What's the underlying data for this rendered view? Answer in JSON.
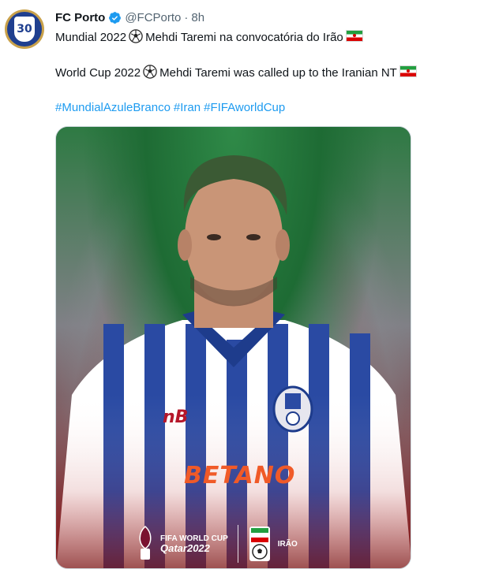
{
  "tweet": {
    "author_name": "FC Porto",
    "handle": "@FCPorto",
    "separator": "·",
    "time": "8h",
    "avatar_text": "30",
    "line1_text": "Mundial 2022",
    "line1_rest": "Mehdi Taremi na convocatória do Irão",
    "line2_text": "World Cup 2022",
    "line2_rest": "Mehdi Taremi was called up to the Iranian NT",
    "hashtags": [
      "#MundialAzuleBranco",
      "#Iran",
      "#FIFAworldCup"
    ]
  },
  "media": {
    "sponsor_text": "BETANO",
    "wc_line1": "FIFA WORLD CUP",
    "wc_line2": "Qatar2022",
    "team_label": "IRÃO"
  },
  "colors": {
    "link": "#1d9bf0",
    "verified": "#1d9bf0",
    "muted": "#536471"
  },
  "icons": [
    "verified-badge-icon",
    "soccer-ball-icon",
    "iran-flag-icon"
  ]
}
